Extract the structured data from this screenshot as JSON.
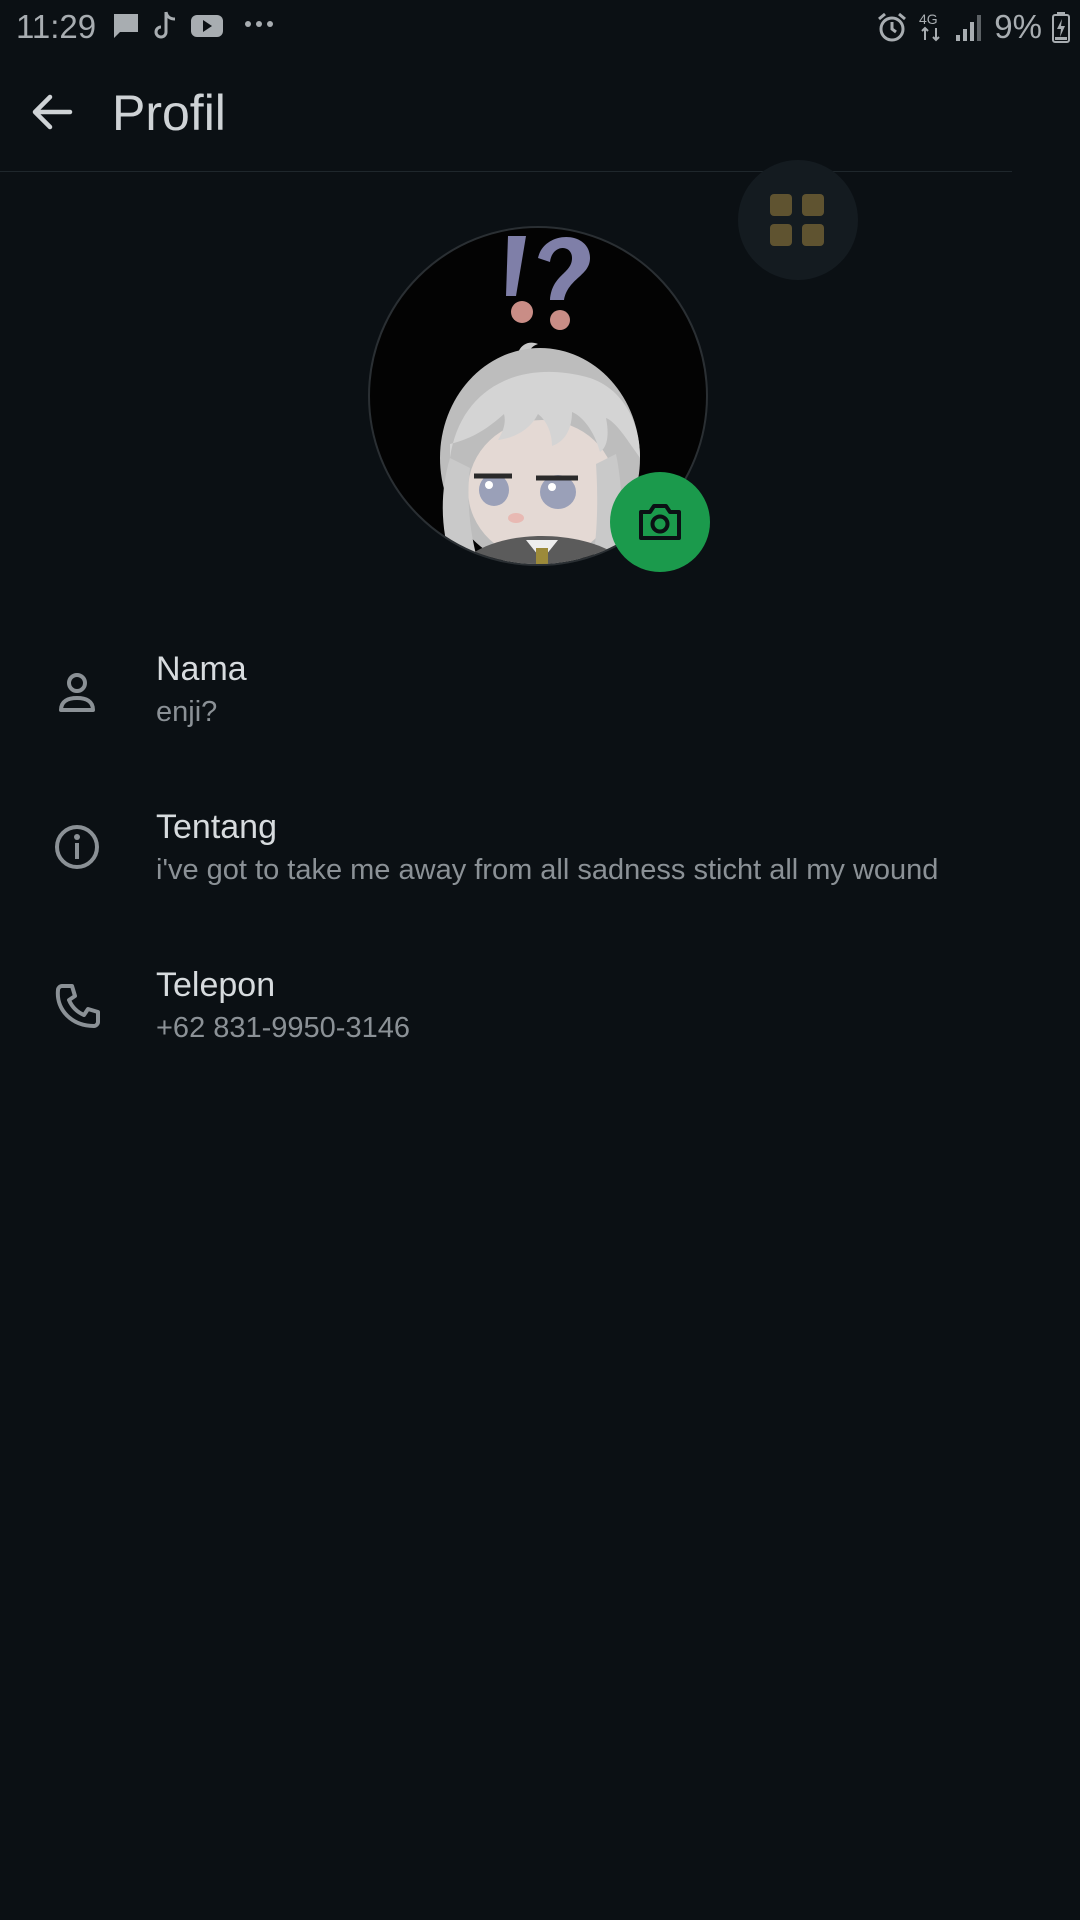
{
  "status_bar": {
    "time": "11:29",
    "battery": "9%",
    "network": "4G",
    "notification_icons": [
      "message-icon",
      "tiktok-icon",
      "youtube-icon",
      "more-dots-icon"
    ],
    "system_icons": [
      "alarm-icon",
      "network-4g-icon",
      "signal-icon",
      "battery-charging-icon"
    ]
  },
  "app_bar": {
    "title": "Profil"
  },
  "profile": {
    "camera_icon": "camera-icon",
    "accent_color": "#1b9a4c"
  },
  "rows": [
    {
      "icon": "person-icon",
      "label": "Nama",
      "value": "enji?"
    },
    {
      "icon": "info-icon",
      "label": "Tentang",
      "value": "i've got to take me away from all sadness sticht all my wound"
    },
    {
      "icon": "phone-icon",
      "label": "Telepon",
      "value": "+62 831-9950-3146"
    }
  ]
}
